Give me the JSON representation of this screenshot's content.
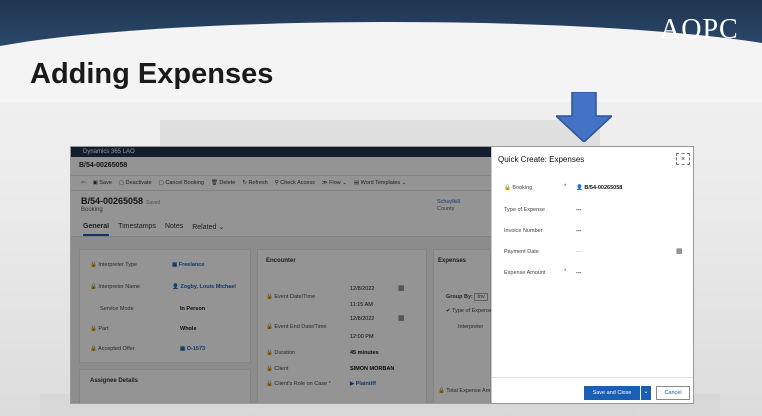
{
  "slide": {
    "logo": "AOPC",
    "title": "Adding Expenses"
  },
  "colors": {
    "header": "#1f3550",
    "arrow": "#4472c4",
    "primary_button": "#1a5fb4"
  },
  "app": {
    "topbar": "Dynamics 365    LAO",
    "record_bar": "B/54-00265058",
    "commands": [
      "Save",
      "Deactivate",
      "Cancel Booking",
      "Delete",
      "Refresh",
      "Check Access",
      "Flow",
      "Word Templates"
    ],
    "header": {
      "record_id": "B/54-00265058",
      "saved": "Saved",
      "entity": "Booking",
      "county_value": "Schuylkill",
      "county_label": "County"
    },
    "tabs": [
      "General",
      "Timestamps",
      "Notes",
      "Related"
    ],
    "general": {
      "interpreter_type_label": "Interpreter Type",
      "interpreter_type_value": "Freelance",
      "interpreter_name_label": "Interpreter Name",
      "interpreter_name_value": "Zogby, Louis Michael",
      "service_mode_label": "Service Mode",
      "service_mode_value": "In Person",
      "part_label": "Part",
      "part_value": "Whole",
      "accepted_offer_label": "Accepted Offer",
      "accepted_offer_value": "O-1573",
      "assignee_details": "Assignee Details"
    },
    "encounter": {
      "title": "Encounter",
      "event_date_label": "Event Date/Time",
      "event_date": "12/8/2022",
      "event_time": "11:15 AM",
      "event_end_label": "Event End Date/Time",
      "event_end_date": "12/8/2022",
      "event_end_time": "12:00 PM",
      "duration_label": "Duration",
      "duration_value": "45 minutes",
      "client_label": "Client",
      "client_value": "SIMON MORBAN",
      "role_label": "Client's Role on Case",
      "role_value": "Plaintiff"
    },
    "expenses": {
      "title": "Expenses",
      "group_by_label": "Group By:",
      "group_by_value": "Inv",
      "type_col": "Type of Expense",
      "interpreter": "Interpreter",
      "total_label": "Total Expense Am"
    }
  },
  "quick_create": {
    "title": "Quick Create: Expenses",
    "close": "×",
    "booking_label": "Booking",
    "booking_value": "B/54-00265058",
    "type_label": "Type of Expense",
    "type_value": "---",
    "invoice_label": "Invoice Number",
    "invoice_value": "---",
    "payment_label": "Payment Date",
    "payment_value": "---",
    "amount_label": "Expense Amount",
    "amount_value": "---",
    "save_close": "Save and Close",
    "cancel": "Cancel"
  }
}
